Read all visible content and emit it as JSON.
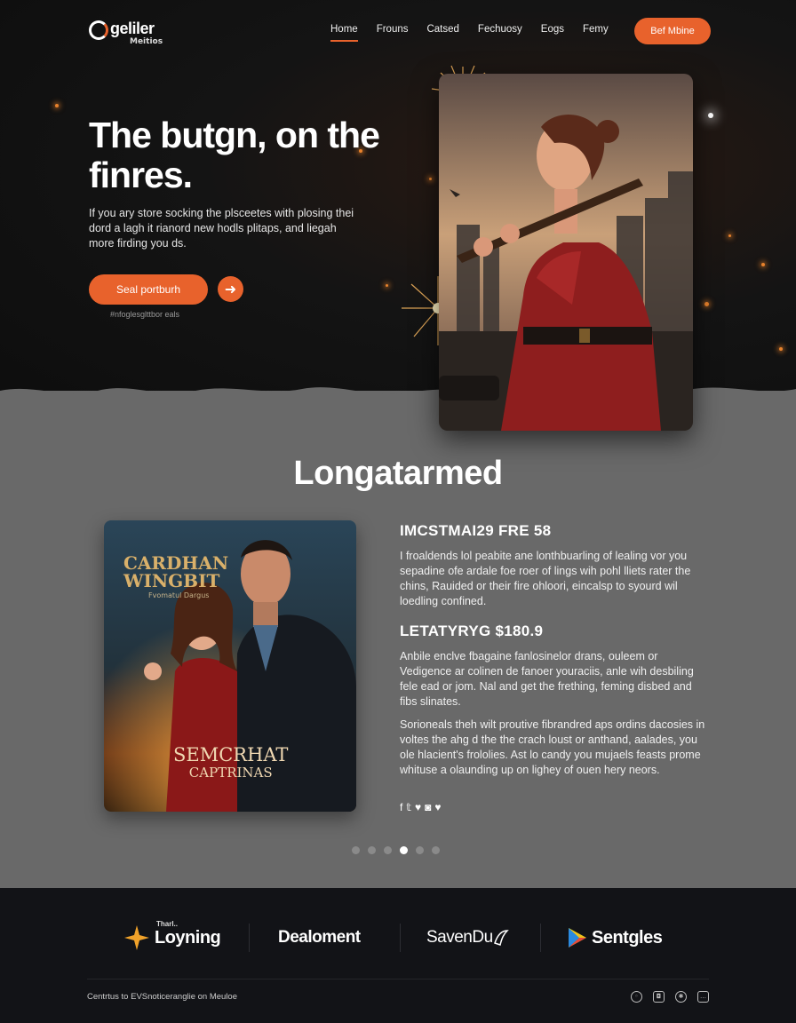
{
  "brand": {
    "title": "geliler",
    "subtitle": "Meitios"
  },
  "nav": {
    "links": [
      "Home",
      "Frouns",
      "Catsed",
      "Fechuosy",
      "Eogs",
      "Femy"
    ],
    "active_index": 0,
    "cta_label": "Bef Mbine"
  },
  "hero": {
    "title": "The butgn, on the finres.",
    "text": "If you ary store socking the plsceetes with plosing thei dord a lagh it rianord new hodls plitaps, and liegah more firding you ds.",
    "button_label": "Seal portburh",
    "arrow": "➜",
    "note": "#nfoglesglttbor eals"
  },
  "section": {
    "title": "Longatarmed",
    "poster": {
      "top_line1": "CARDHAN",
      "top_line2": "WINGBIT",
      "tagline": "Fvomatul Dargus",
      "bottom_line1": "SEMCRHAT",
      "bottom_line2": "CAPTRINAS"
    },
    "heading_a": "IMCSTMAI29 FRE 58",
    "para_a": "I froaldends lol peabite ane lonthbuarling of lealing vor you sepadine ofe ardale foe roer of lings wih pohl lliets rater the chins, Rauided or their fire ohloori, eincalsp to syourd wil loedling confined.",
    "heading_b": "LETATYRYG $180.9",
    "para_b": "Anbile enclve fbagaine fanlosinelor drans, ouleem or Vedigence ar colinen de fanoer youraciis, anle wih desbiling fele ead or jom. Nal and get the frething, feming disbed and fibs slinates.",
    "para_c": "Sorioneals theh wilt proutive fibrandred aps ordins dacosies in voltes the ahg d the the crach loust or anthand, aalades, you ole hlacient's frololies. Ast lo candy you mujaels feasts prome whituse a olaunding up on lighey of ouen hery neors.",
    "socials": [
      "f",
      "𝕥",
      "♥",
      "◙",
      "♥"
    ],
    "carousel": {
      "count": 6,
      "active_index": 3
    }
  },
  "footer": {
    "partners": [
      {
        "name": "Loyning",
        "small": "Tharl..",
        "icon": "star-icon"
      },
      {
        "name": "Dealoment",
        "icon": ""
      },
      {
        "name": "SavenDu",
        "icon": "bird-icon"
      },
      {
        "name": "Sentgles",
        "icon": "play-icon"
      }
    ],
    "copyright": "Centrtus to EVSnoticeranglie on Meuloe",
    "icons": [
      "circle-icon",
      "camera-icon",
      "globe-icon",
      "chat-icon"
    ]
  },
  "colors": {
    "accent": "#e8622c",
    "grey": "#696969",
    "dark": "#121317"
  }
}
